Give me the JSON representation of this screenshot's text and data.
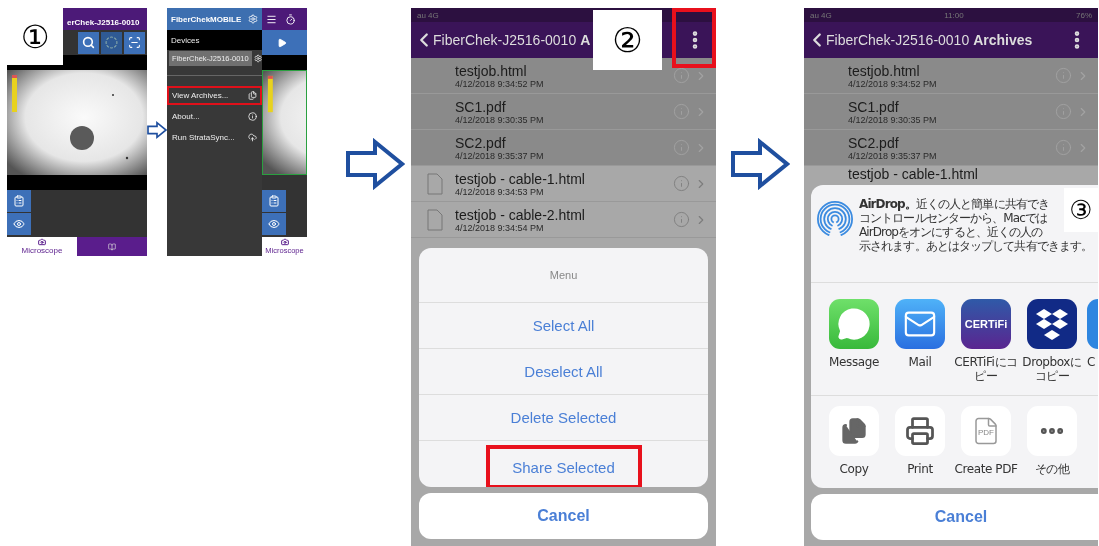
{
  "step_labels": [
    "①",
    "②",
    "③"
  ],
  "screen1": {
    "title": "erChek-J2516-0010",
    "tabs": [
      {
        "label": "Microscope",
        "selected": true
      },
      {
        "selected": false
      }
    ]
  },
  "drawer": {
    "app_title": "FiberChekMOBILE",
    "section": "Devices",
    "device": "FiberChek-J2516-0010",
    "items": [
      {
        "label": "View Archives...",
        "kind": "archive",
        "highlighted": true
      },
      {
        "label": "About...",
        "kind": "info",
        "highlighted": false
      },
      {
        "label": "Run StrataSync...",
        "kind": "cloud",
        "highlighted": false
      }
    ],
    "peek_tab": "Microscope"
  },
  "screen2": {
    "status": {
      "carrier": "au 4G"
    },
    "back": "FiberChek-J2516-0010",
    "title": "A",
    "menu_highlighted": true,
    "files": [
      {
        "name": "testjob.html",
        "date": "4/12/2018 9:34:52 PM",
        "selected": true
      },
      {
        "name": "SC1.pdf",
        "date": "4/12/2018 9:30:35 PM",
        "selected": true
      },
      {
        "name": "SC2.pdf",
        "date": "4/12/2018 9:35:37 PM",
        "selected": true
      },
      {
        "name": "testjob - cable-1.html",
        "date": "4/12/2018 9:34:53 PM",
        "selected": false
      },
      {
        "name": "testjob - cable-2.html",
        "date": "4/12/2018 9:34:54 PM",
        "selected": false
      }
    ],
    "sheet": {
      "title": "Menu",
      "actions": [
        {
          "label": "Select All",
          "highlighted": false
        },
        {
          "label": "Deselect All",
          "highlighted": false
        },
        {
          "label": "Delete Selected",
          "highlighted": false
        },
        {
          "label": "Share Selected",
          "highlighted": true
        }
      ],
      "cancel": "Cancel"
    }
  },
  "screen3": {
    "status": {
      "carrier": "au 4G",
      "time": "11:00",
      "battery": "76%"
    },
    "back": "FiberChek-J2516-0010",
    "title": "Archives",
    "files": [
      {
        "name": "testjob.html",
        "date": "4/12/2018 9:34:52 PM",
        "selected": true
      },
      {
        "name": "SC1.pdf",
        "date": "4/12/2018 9:30:35 PM",
        "selected": true
      },
      {
        "name": "SC2.pdf",
        "date": "4/12/2018 9:35:37 PM",
        "selected": true
      },
      {
        "name": "testjob - cable-1.html",
        "selected": false
      }
    ],
    "share": {
      "airdrop_lines": [
        "**AirDrop。**近くの人と簡単に共有でき",
        "コントロールセンターから、Macでは",
        "AirDropをオンにすると、近くの人の",
        "示されます。あとはタップして共有できます。"
      ],
      "apps": [
        {
          "label": "Message",
          "kind": "message"
        },
        {
          "label": "Mail",
          "kind": "mail"
        },
        {
          "label": "CERTiFiにコピー",
          "kind": "certifi",
          "icon_text": "CERTiFi"
        },
        {
          "label": "Dropboxにコピー",
          "kind": "dropbox"
        },
        {
          "label": "C",
          "kind": "cut"
        }
      ],
      "actions": [
        {
          "label": "Copy",
          "kind": "copy"
        },
        {
          "label": "Print",
          "kind": "print"
        },
        {
          "label": "Create PDF",
          "kind": "pdf",
          "icon_text": "PDF"
        },
        {
          "label": "その他",
          "kind": "more"
        }
      ],
      "cancel": "Cancel"
    }
  }
}
